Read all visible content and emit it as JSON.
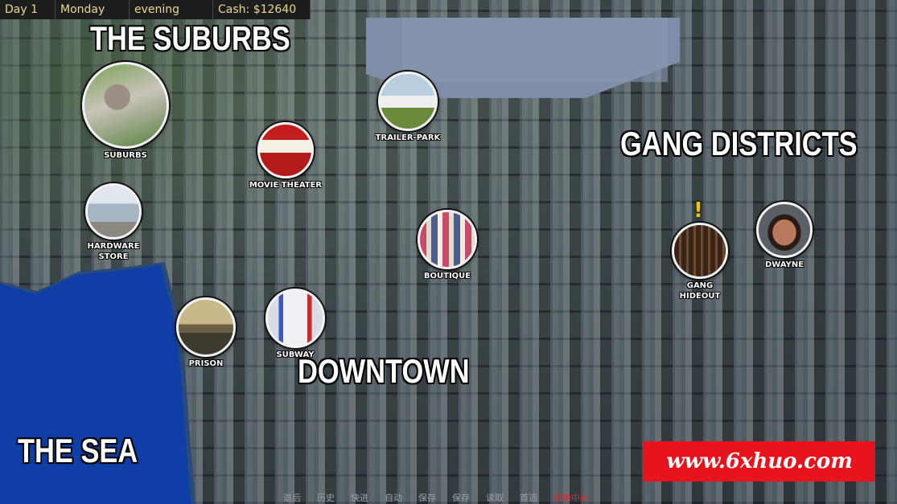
{
  "hud": {
    "day": "Day 1",
    "weekday": "Monday",
    "time_of_day": "evening",
    "cash": "Cash: $12640"
  },
  "regions": {
    "suburbs": "THE SUBURBS",
    "gang_districts": "GANG DISTRICTS",
    "downtown": "DOWNTOWN",
    "sea": "THE SEA"
  },
  "locations": {
    "suburbs": "SUBURBS",
    "trailer_park": "TRAILER-PARK",
    "movie_theater": "MOVIE THEATER",
    "hardware_store": "HARDWARE\nSTORE",
    "boutique": "BOUTIQUE",
    "gang_hideout": "GANG\nHIDEOUT",
    "dwayne": "DWAYNE",
    "prison": "PRISON",
    "subway": "SUBWAY"
  },
  "alert_marker": "!",
  "watermark": "www.6xhuo.com",
  "quick_menu": [
    "退后",
    "历史",
    "快进",
    "自动",
    "保存",
    "保存",
    "读取",
    "首选",
    "菜单中心"
  ],
  "colors": {
    "hud_text": "#e9d892",
    "sea": "#0f3fa6",
    "watermark_bg": "#e8141d",
    "alert": "#f5c400"
  }
}
